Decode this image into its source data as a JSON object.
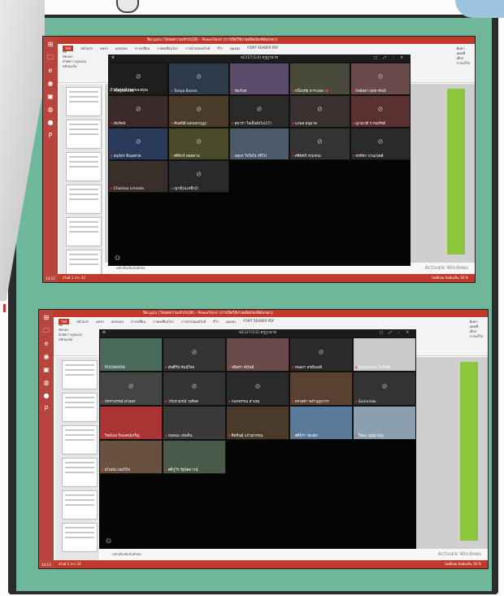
{
  "screens": [
    {
      "id": "s1",
      "titlebar": "ฟิส.pptx (โหมดความเข้ากันได้) - PowerPoint (การเปิดใช้งานผลิตภัณฑ์ล้มเหลว)",
      "tabs": [
        "ไฟล์",
        "หน้าแรก",
        "แทรก",
        "ออกแบบ",
        "การเปลี่ยน",
        "ภาพเคลื่อนไหว",
        "การนำเสนอสไลด์",
        "รีวิว",
        "มุมมอง",
        "FOXIT READER PDF"
      ],
      "ribbon_left": [
        "ตัด",
        "คัดลอก",
        "ตัวคัดวางรูปแบบ",
        "คลิปบอร์ด"
      ],
      "ribbon_right": [
        "ค้นหา",
        "แทนที่",
        "เลือก",
        "การแก้ไข"
      ],
      "meet_title": "ห2127(1/4) ครูภูวนาท",
      "notes": "คลิกเพื่อเพิ่มบันทึกย่อ",
      "watermark": "Activate Windows",
      "status": "สไลด์ 1 จาก 32",
      "status_right": "บันทึกย่อ  ข้อคิดเห็น  78 %",
      "clock": "14:12",
      "presenter_caption": "กำลังดูหน้าจอของคุณ",
      "tiles": [
        {
          "name": "POOWARIN",
          "cam": false,
          "color": "#1e1e1e"
        },
        {
          "name": "Tanya Bunxx",
          "cam": false,
          "color": "#2e3a4a"
        },
        {
          "name": "ชนกันท",
          "cam": true,
          "color": "#5c4a6a"
        },
        {
          "name": "หนึ่งฤทัย ยาระยอง 💗",
          "cam": true,
          "color": "#4a4a3a"
        },
        {
          "name": "กัลย์สุดา ยุทธาพันธ์",
          "cam": false,
          "color": "#6a4a4a"
        },
        {
          "name": "พันรัตน์",
          "cam": false,
          "color": "#3a2a2a"
        },
        {
          "name": "ศันสนีย์ แสงเสก(บุฎ)",
          "cam": false,
          "color": "#4a3a2a"
        },
        {
          "name": "สุขวรา ใจเย็นยังไง(27)",
          "cam": false,
          "color": "#2a2a2a"
        },
        {
          "name": "นวพล อนุมาส",
          "cam": false,
          "color": "#3a3030"
        },
        {
          "name": "ญาณวดี กาจนรัชต์",
          "cam": false,
          "color": "#5a3030"
        },
        {
          "name": "อนุกัตร สินเผคาด",
          "cam": false,
          "color": "#2a3a5a"
        },
        {
          "name": "ศศิจักร์ ดอยตาน",
          "cam": false,
          "color": "#4a4a2a"
        },
        {
          "name": "จตุพร ใจใจใจ (ซีโร่)",
          "cam": true,
          "color": "#4a5a6a"
        },
        {
          "name": "ศศิพัชร์ กรมชวย",
          "cam": false,
          "color": "#333"
        },
        {
          "name": "ทรพีชา ปานเขตต์",
          "cam": false,
          "color": "#2a2a2a"
        },
        {
          "name": "Chorkaa Limsele",
          "cam": true,
          "color": "#3a2e2a"
        },
        {
          "name": "ญาณิ(บะหฮิ)😊",
          "cam": false,
          "color": "#2a2a2a"
        }
      ]
    },
    {
      "id": "s2",
      "titlebar": "ฟิส.pptx (โหมดความเข้ากันได้) - PowerPoint (การเปิดใช้งานผลิตภัณฑ์ล้มเหลว)",
      "tabs": [
        "ไฟล์",
        "หน้าแรก",
        "แทรก",
        "ออกแบบ",
        "การเปลี่ยน",
        "ภาพเคลื่อนไหว",
        "การนำเสนอสไลด์",
        "รีวิว",
        "มุมมอง",
        "FOXIT READER PDF"
      ],
      "ribbon_left": [
        "ตัด",
        "คัดลอก",
        "ตัวคัดวางรูปแบบ",
        "คลิปบอร์ด"
      ],
      "ribbon_right": [
        "ค้นหา",
        "แทนที่",
        "เลือก",
        "การแก้ไข"
      ],
      "meet_title": "ห2127(1/2) ครูภูวนาท",
      "notes": "คลิกเพื่อเพิ่มบันทึกย่อ",
      "watermark": "Activate Windows",
      "status": "สไลด์ 1 จาก 32",
      "status_right": "บันทึกย่อ  ข้อคิดเห็น  78 %",
      "clock": "14:13",
      "tiles": [
        {
          "name": "POOWARIN",
          "cam": true,
          "color": "#4a6a5a"
        },
        {
          "name": "ดันศิริน์ พันธุ์ใหม่",
          "cam": false,
          "color": "#333"
        },
        {
          "name": "ชนิสรา สีเงินมี",
          "cam": true,
          "color": "#6a4a4a"
        },
        {
          "name": "หนองฯ ธรณินนท์",
          "cam": false,
          "color": "#2a2a2a"
        },
        {
          "name": "ธัญญลักษณ์ โพริเตย์",
          "cam": true,
          "color": "#c9c9c9"
        },
        {
          "name": "ภัทราพรรณ์ ผ่านพร",
          "cam": false,
          "color": "#444"
        },
        {
          "name": "วรันรามรณ์ วงศ์ยศ",
          "cam": false,
          "color": "#333"
        },
        {
          "name": "กนกพรรณ สาเหตุ",
          "cam": false,
          "color": "#2a2a2a"
        },
        {
          "name": "ตรวยศา หล้านุกูลากร",
          "cam": true,
          "color": "#5a4030"
        },
        {
          "name": "Sunnchak",
          "cam": false,
          "color": "#333"
        },
        {
          "name": "วิทย์เมธ กิจเจตน์เจริญ",
          "cam": true,
          "color": "#a33"
        },
        {
          "name": "กฤษณะ สุขเดิน",
          "cam": true,
          "color": "#3a3a3a"
        },
        {
          "name": "ศิลชินตุ้ แก้วสุวรรณ",
          "cam": true,
          "color": "#4a3a2a"
        },
        {
          "name": "ศศินิรา ช่องฝัก",
          "cam": true,
          "color": "#5a7a9a"
        },
        {
          "name": "วิษณุ ปุญญาปัญ",
          "cam": true,
          "color": "#8aa0b0"
        },
        {
          "name": "อโนพัน เขมวิภิก",
          "cam": true,
          "color": "#6a5040"
        },
        {
          "name": "ศศิภูวิร รัฐปัตดาวน์",
          "cam": true,
          "color": "#4a5a4a"
        }
      ]
    }
  ],
  "colors": {
    "accent": "#c0392b",
    "sheet": "#6fb79a",
    "meet_bg": "#050505"
  }
}
